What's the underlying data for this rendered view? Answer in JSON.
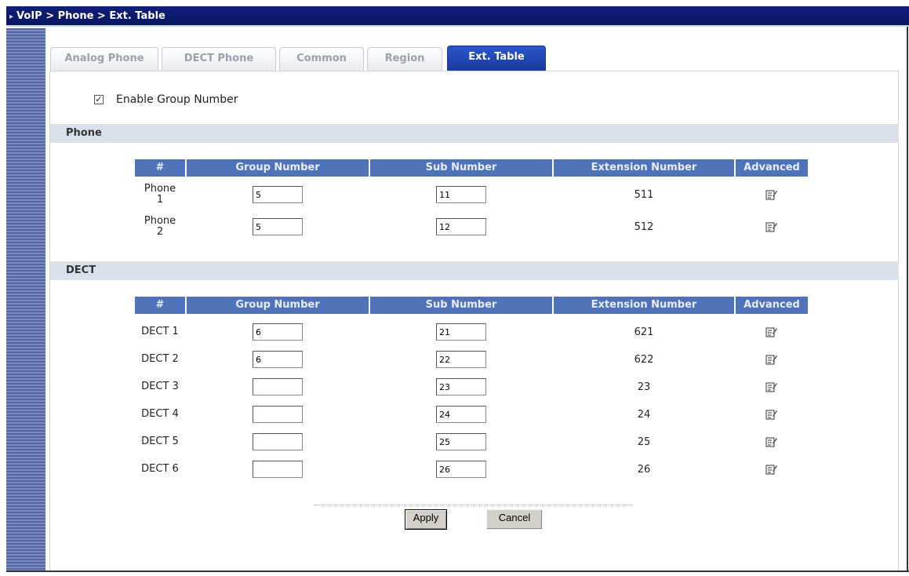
{
  "breadcrumb": "VoIP > Phone > Ext. Table",
  "tabs": [
    {
      "label": "Analog Phone",
      "active": false
    },
    {
      "label": "DECT Phone",
      "active": false
    },
    {
      "label": "Common",
      "active": false
    },
    {
      "label": "Region",
      "active": false
    },
    {
      "label": "Ext. Table",
      "active": true
    }
  ],
  "enable_group": {
    "label": "Enable Group Number",
    "checked": true
  },
  "phone_section": {
    "title": "Phone",
    "headers": [
      "#",
      "Group Number",
      "Sub Number",
      "Extension Number",
      "Advanced"
    ],
    "rows": [
      {
        "label_line1": "Phone",
        "label_line2": "1",
        "group": "5",
        "sub": "11",
        "ext": "511"
      },
      {
        "label_line1": "Phone",
        "label_line2": "2",
        "group": "5",
        "sub": "12",
        "ext": "512"
      }
    ]
  },
  "dect_section": {
    "title": "DECT",
    "headers": [
      "#",
      "Group Number",
      "Sub Number",
      "Extension Number",
      "Advanced"
    ],
    "rows": [
      {
        "label": "DECT 1",
        "group": "6",
        "sub": "21",
        "ext": "621"
      },
      {
        "label": "DECT 2",
        "group": "6",
        "sub": "22",
        "ext": "622"
      },
      {
        "label": "DECT 3",
        "group": "",
        "sub": "23",
        "ext": "23"
      },
      {
        "label": "DECT 4",
        "group": "",
        "sub": "24",
        "ext": "24"
      },
      {
        "label": "DECT 5",
        "group": "",
        "sub": "25",
        "ext": "25"
      },
      {
        "label": "DECT 6",
        "group": "",
        "sub": "26",
        "ext": "26"
      }
    ]
  },
  "buttons": {
    "apply": "Apply",
    "cancel": "Cancel"
  },
  "colors": {
    "header_bg": "#4f73b8",
    "section_bg": "#d8e0ec",
    "active_tab": "#2c55c8",
    "titlebar": "#12207a"
  }
}
